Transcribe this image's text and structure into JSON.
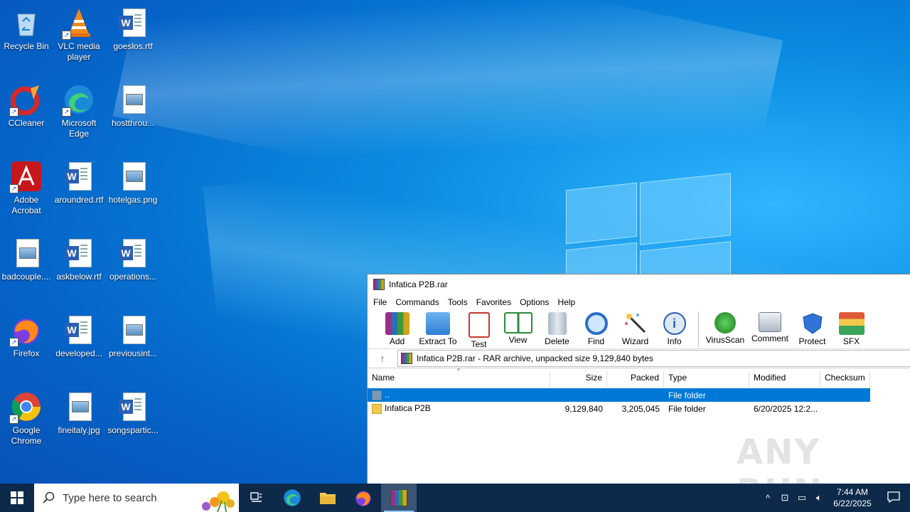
{
  "desktop": {
    "icons": [
      {
        "label": "Recycle Bin"
      },
      {
        "label": "VLC media player"
      },
      {
        "label": "goeslos.rtf"
      },
      {
        "label": "CCleaner"
      },
      {
        "label": "Microsoft Edge"
      },
      {
        "label": "hostthrou..."
      },
      {
        "label": "Adobe Acrobat"
      },
      {
        "label": "aroundred.rtf"
      },
      {
        "label": "hotelgas.png"
      },
      {
        "label": "badcouple...."
      },
      {
        "label": "askbelow.rtf"
      },
      {
        "label": "operations..."
      },
      {
        "label": "Firefox"
      },
      {
        "label": "developed..."
      },
      {
        "label": "previousint..."
      },
      {
        "label": "Google Chrome"
      },
      {
        "label": "fineitaly.jpg"
      },
      {
        "label": "songspartic..."
      }
    ]
  },
  "winrar": {
    "title": "Infatica P2B.rar",
    "menu": [
      "File",
      "Commands",
      "Tools",
      "Favorites",
      "Options",
      "Help"
    ],
    "toolbar": [
      "Add",
      "Extract To",
      "Test",
      "View",
      "Delete",
      "Find",
      "Wizard",
      "Info",
      "VirusScan",
      "Comment",
      "Protect",
      "SFX"
    ],
    "address": "Infatica P2B.rar - RAR archive, unpacked size 9,129,840 bytes",
    "columns": {
      "name": "Name",
      "size": "Size",
      "packed": "Packed",
      "type": "Type",
      "modified": "Modified",
      "checksum": "Checksum"
    },
    "rows": [
      {
        "name": "..",
        "size": "",
        "packed": "",
        "type": "File folder",
        "modified": "",
        "checksum": ""
      },
      {
        "name": "Infatica P2B",
        "size": "9,129,840",
        "packed": "3,205,045",
        "type": "File folder",
        "modified": "6/20/2025 12:2...",
        "checksum": ""
      }
    ]
  },
  "watermark": "ANY RUN",
  "taskbar": {
    "search_placeholder": "Type here to search",
    "time": "7:44 AM",
    "date": "6/22/2025"
  }
}
